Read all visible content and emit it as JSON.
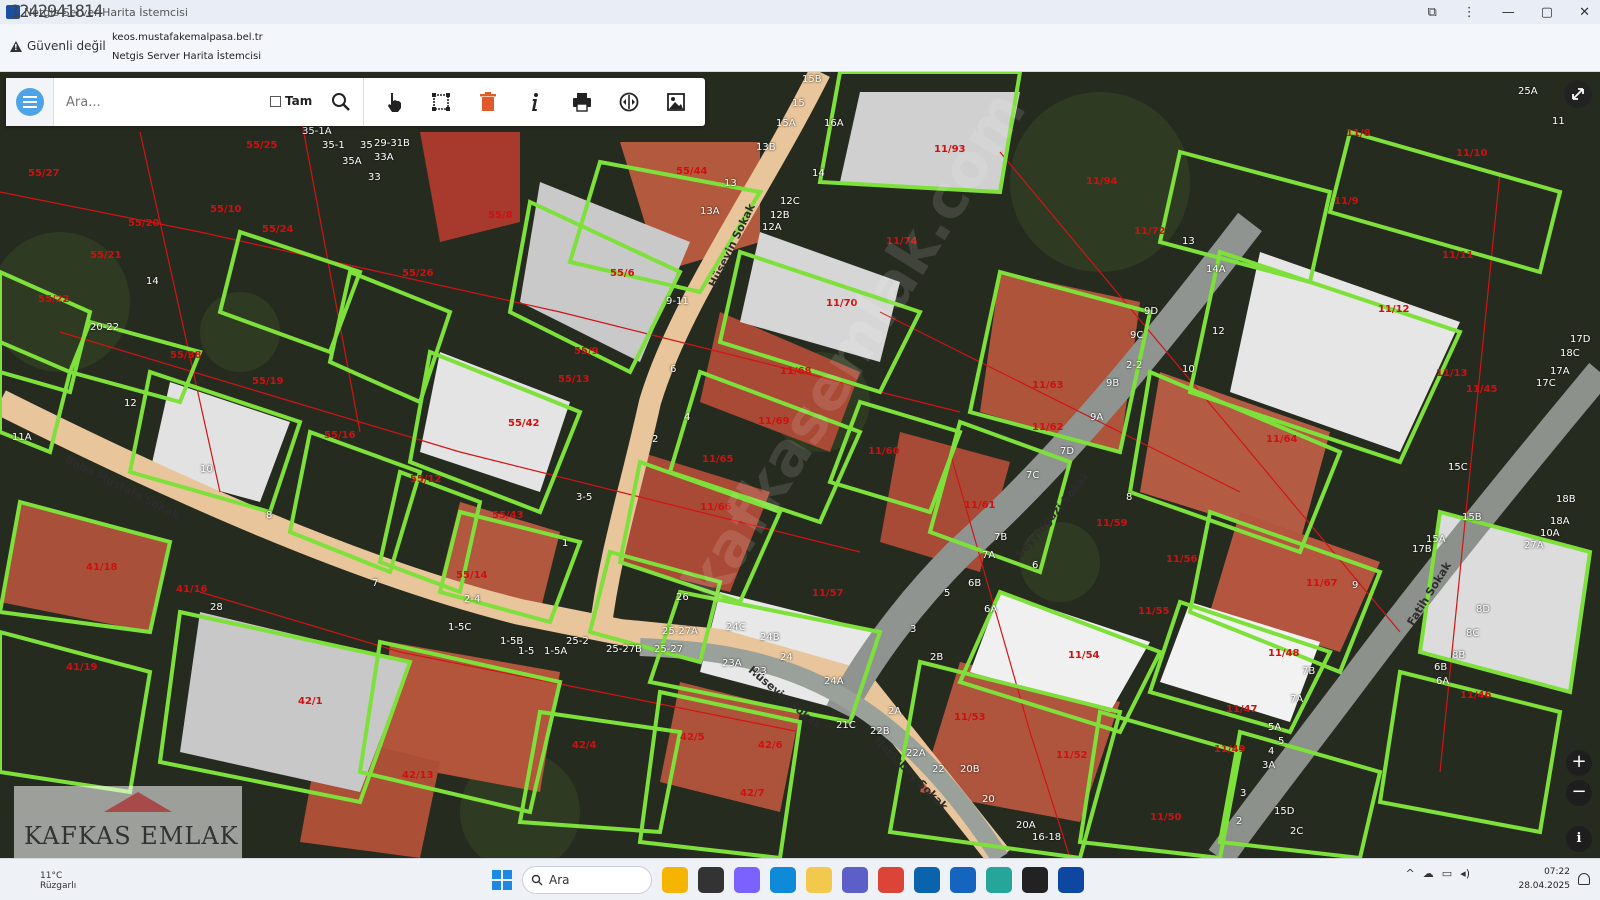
{
  "window": {
    "overlay_id": "1242941814",
    "title": "Netgis Server Harita İstemcisi"
  },
  "browser": {
    "security_label": "Güvenli değil",
    "url": "keos.mustafakemalpasa.bel.tr",
    "page_title": "Netgis Server Harita İstemcisi"
  },
  "toolbar": {
    "search_placeholder": "Ara...",
    "tam_label": "Tam",
    "tools": [
      "pointer-tool",
      "select-box-tool",
      "delete-tool",
      "info-tool",
      "print-tool",
      "measure-tool",
      "image-export-tool"
    ]
  },
  "streets": [
    {
      "id": "baba-mustafa",
      "label": "Baba Mustafa Sokak"
    },
    {
      "id": "huseyin",
      "label": "Hüseyin Sokak"
    },
    {
      "id": "seyyidgazi",
      "label": "Seyyidgazi Sokak"
    },
    {
      "id": "fatih",
      "label": "Fatih Sokak"
    },
    {
      "id": "hakkibey",
      "label": "Hakkıbey Sokak"
    },
    {
      "id": "huseyin2",
      "label": "Hüseyin Sokak"
    }
  ],
  "parcels": [
    "11/70",
    "11/74",
    "11/68",
    "11/63",
    "11/93",
    "11/94",
    "11/12",
    "11/13",
    "11/11",
    "11/10",
    "11/67",
    "11/69",
    "11/66",
    "11/65",
    "11/64",
    "11/62",
    "11/72",
    "11/61",
    "11/60",
    "11/59",
    "11/55",
    "11/56",
    "11/57",
    "11/54",
    "11/53",
    "11/52",
    "11/50",
    "11/49",
    "11/48",
    "11/47",
    "11/46",
    "11/45",
    "11/8",
    "11/9",
    "55/44",
    "55/42",
    "55/43",
    "55/10",
    "55/12",
    "55/13",
    "55/14",
    "55/16",
    "55/20",
    "55/21",
    "55/22",
    "55/24",
    "55/25",
    "55/26",
    "55/9",
    "55/6",
    "55/8",
    "55/38",
    "55/19",
    "55/27",
    "41/18",
    "41/16",
    "41/19",
    "42/1",
    "42/4",
    "42/5",
    "42/6",
    "42/7",
    "42/13"
  ],
  "numbers": [
    "15B",
    "15",
    "15A",
    "16A",
    "14",
    "13B",
    "13",
    "13A",
    "12C",
    "12B",
    "12A",
    "9-11",
    "6",
    "4",
    "2",
    "3-5",
    "1",
    "2-4",
    "1-5C",
    "1-5B",
    "1-5",
    "1-5A",
    "25-2",
    "25-27A",
    "25-27B",
    "25-27",
    "24C",
    "24B",
    "24",
    "24A",
    "23A",
    "23",
    "21C",
    "22B",
    "22A",
    "22",
    "20B",
    "20",
    "20A",
    "16-18",
    "26",
    "35",
    "35A",
    "33",
    "33A",
    "29-31B",
    "35-1A",
    "35-1",
    "10",
    "12",
    "20-22",
    "14",
    "11A",
    "8",
    "7",
    "9D",
    "9C",
    "9B",
    "9A",
    "7D",
    "7C",
    "7B",
    "7A",
    "8",
    "6B",
    "6A",
    "6",
    "5",
    "3",
    "2B",
    "2A",
    "14A",
    "12",
    "10",
    "9",
    "8D",
    "8C",
    "8B",
    "6B",
    "6A",
    "7B",
    "7A",
    "5A",
    "5",
    "4",
    "3A",
    "3",
    "2",
    "2C",
    "15D",
    "15C",
    "15B",
    "15A",
    "17B",
    "17A",
    "17C",
    "17D",
    "18C",
    "18B",
    "18A",
    "10A",
    "27A",
    "25A",
    "11",
    "13",
    "2-2",
    "28"
  ],
  "watermark": {
    "brand": "KAFKAS EMLAK",
    "diagonal": "kafkasemlak.com"
  },
  "map_controls": {
    "zoom_in": "+",
    "zoom_out": "−",
    "info": "i"
  },
  "taskbar": {
    "weather_temp": "11°C",
    "weather_cond": "Rüzgarlı",
    "search_label": "Ara",
    "time": "07:22",
    "date": "28.04.2025"
  },
  "colors": {
    "parcel_outline": "#7ee03a",
    "cadastre_line": "#d11414",
    "road_fill": "#e9c79a",
    "roof_red": "#b5593d",
    "map_dark": "#23281e"
  }
}
